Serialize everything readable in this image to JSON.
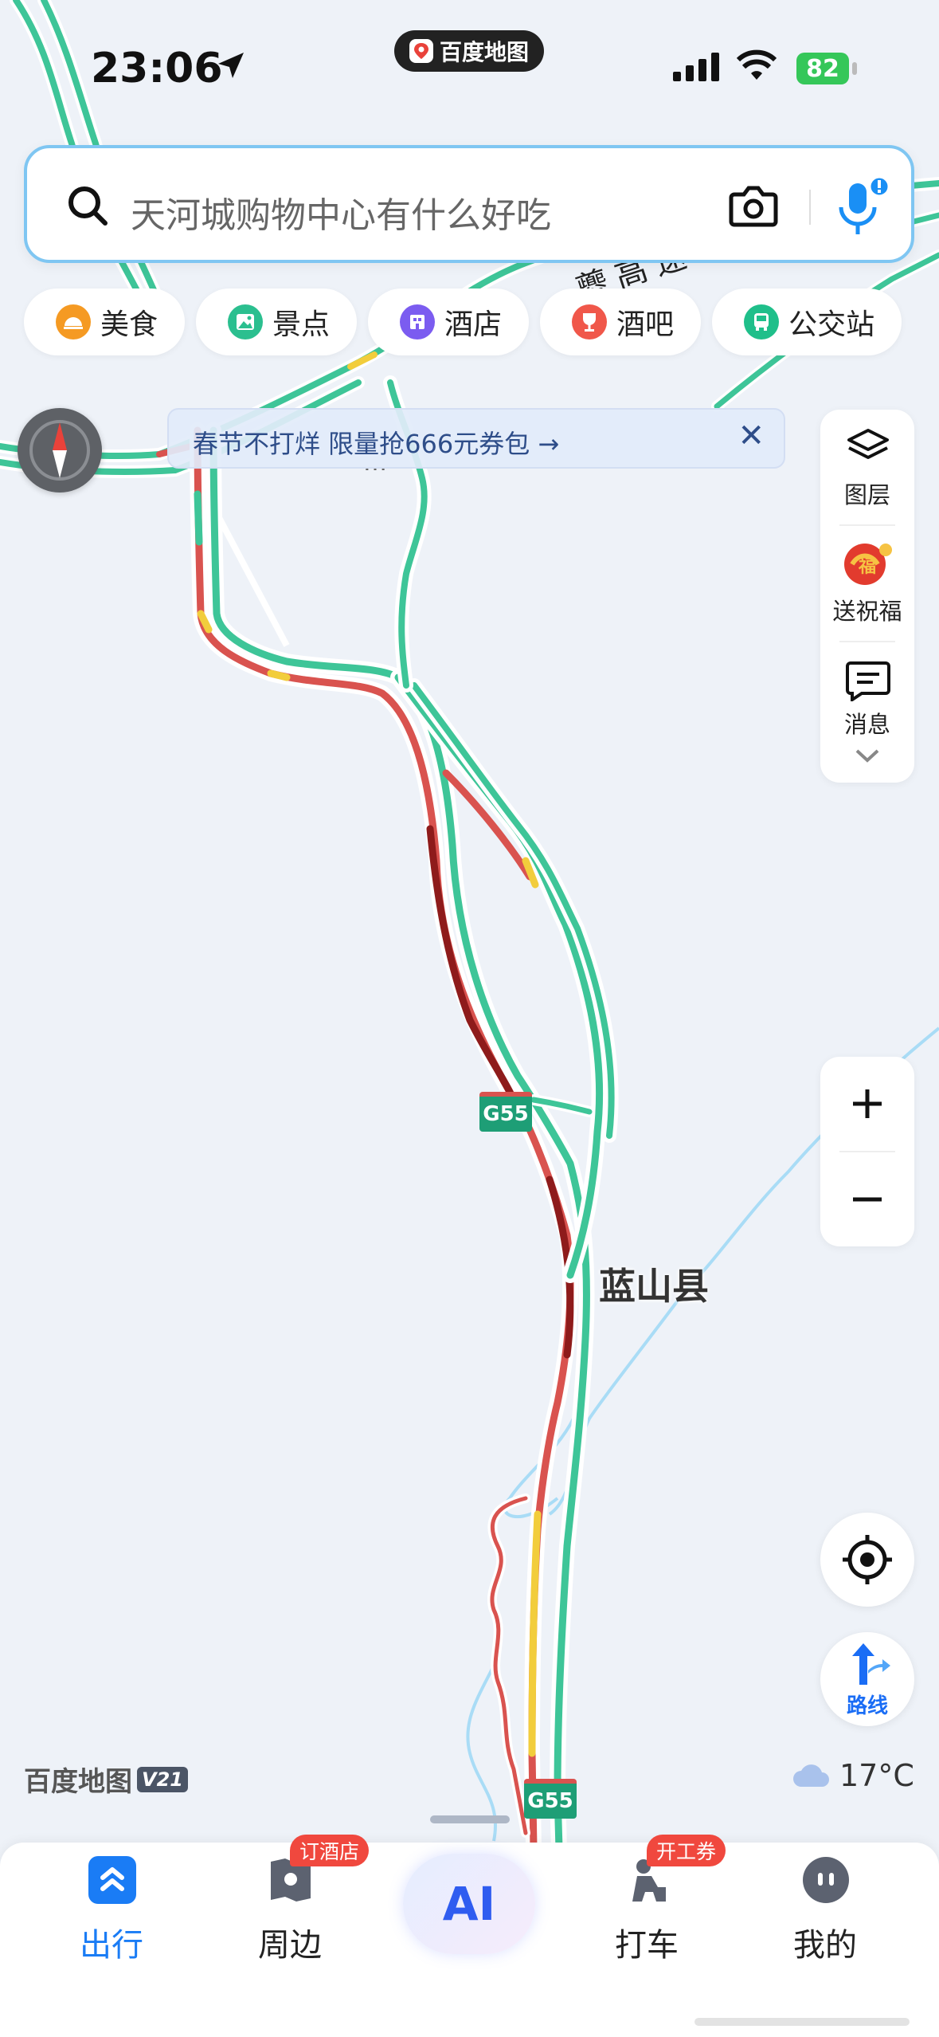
{
  "status_bar": {
    "time": "23:06",
    "app_name": "百度地图",
    "battery": "82"
  },
  "search": {
    "placeholder": "天河城购物中心有什么好吃"
  },
  "categories": [
    {
      "label": "美食",
      "color": "#f59a23"
    },
    {
      "label": "景点",
      "color": "#2bbf8f"
    },
    {
      "label": "酒店",
      "color": "#7b5cf0"
    },
    {
      "label": "酒吧",
      "color": "#f0574a"
    },
    {
      "label": "公交站",
      "color": "#1fbf8a"
    }
  ],
  "promo": {
    "text": "春节不打烊 限量抢666元券包 →",
    "close": "✕"
  },
  "side_panel": {
    "layers": "图层",
    "blessing": "送祝福",
    "message": "消息"
  },
  "map": {
    "county_label": "蓝山县",
    "shields": [
      "G55",
      "G55"
    ],
    "partial_road_label": "夔 高 速",
    "colors": {
      "expressway": "#3ec598",
      "congested": "#d9534f",
      "heavy": "#8e1b1b",
      "slow": "#f2cd3c",
      "river": "#9dd7f4"
    }
  },
  "bottom": {
    "brand": "百度地图",
    "version": "V21",
    "weather": "17°C"
  },
  "tabs": [
    {
      "label": "出行",
      "active": true
    },
    {
      "label": "周边",
      "badge": "订酒店"
    },
    {
      "label": "AI"
    },
    {
      "label": "打车",
      "badge": "开工券"
    },
    {
      "label": "我的"
    }
  ]
}
